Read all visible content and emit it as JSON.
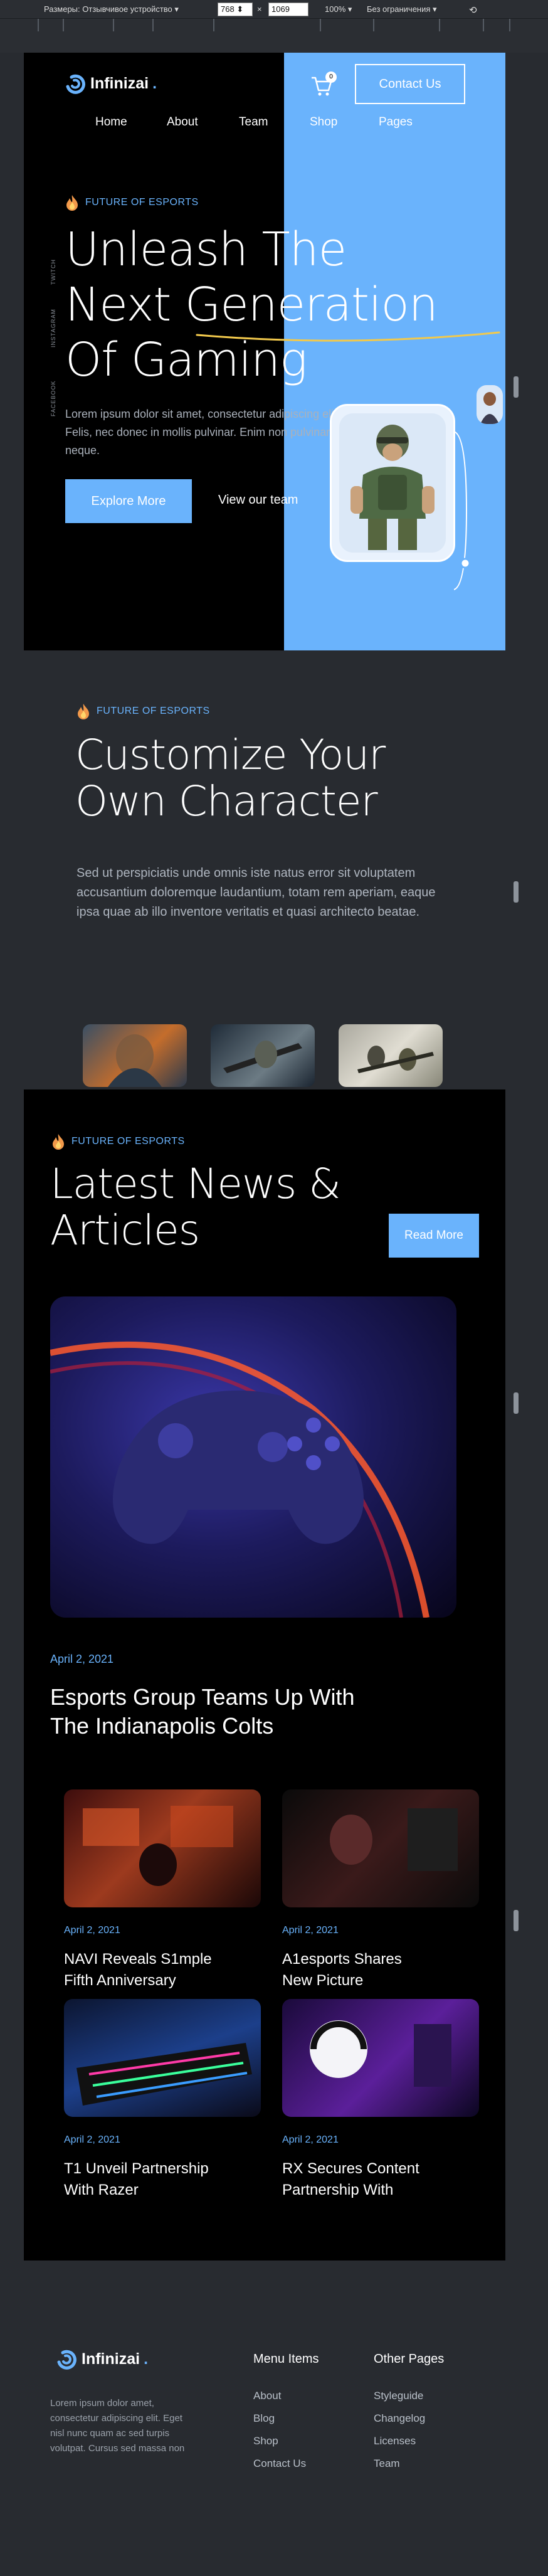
{
  "devtools": {
    "size_label": "Размеры: Отзывчивое устройство ▾",
    "width": "768",
    "times": "×",
    "height": "1069",
    "zoom": "100% ▾",
    "throttle": "Без ограничения ▾"
  },
  "header": {
    "brand": "Infinizai",
    "brand_dot": ".",
    "cart_count": "0",
    "contact_label": "Contact Us",
    "nav": [
      "Home",
      "About",
      "Team",
      "Shop",
      "Pages"
    ]
  },
  "hero": {
    "eyebrow": "FUTURE OF ESPORTS",
    "title_line1": "Unleash The",
    "title_line2": "Next Generation",
    "title_line3": "Of Gaming",
    "text": "Lorem ipsum dolor sit amet, consectetur adipiscing elit. Felis, nec donec in mollis pulvinar. Enim non pulvinar neque.",
    "primary_label": "Explore More",
    "secondary_label": "View our team",
    "socials": [
      "TWITCH",
      "INSTAGRAM",
      "FACEBOOK"
    ]
  },
  "customize": {
    "eyebrow": "FUTURE OF ESPORTS",
    "title_line1": "Customize Your",
    "title_line2": "Own Character",
    "text": "Sed ut perspiciatis unde omnis iste natus error sit voluptatem accusantium doloremque laudantium, totam rem aperiam, eaque ipsa quae ab illo inventore veritatis et quasi architecto beatae."
  },
  "news": {
    "eyebrow": "FUTURE OF ESPORTS",
    "title_line1": "Latest News &",
    "title_line2": "Articles",
    "read_more": "Read More",
    "featured": {
      "date": "April 2, 2021",
      "title_line1": "Esports Group Teams Up With",
      "title_line2": "The Indianapolis Colts"
    },
    "articles": [
      {
        "date": "April 2, 2021",
        "title_line1": "NAVI Reveals S1mple",
        "title_line2": "Fifth Anniversary"
      },
      {
        "date": "April 2, 2021",
        "title_line1": "A1esports Shares",
        "title_line2": "New Picture"
      },
      {
        "date": "April 2, 2021",
        "title_line1": "T1 Unveil Partnership",
        "title_line2": "With Razer"
      },
      {
        "date": "April 2, 2021",
        "title_line1": "RX Secures Content",
        "title_line2": "Partnership With"
      }
    ]
  },
  "footer": {
    "brand": "Infinizai",
    "brand_dot": ".",
    "about_lines": [
      "Lorem ipsum dolor amet,",
      "consectetur adipiscing elit. Eget",
      "nisl nunc quam ac sed turpis",
      "volutpat. Cursus sed massa non"
    ],
    "menu_title": "Menu Items",
    "menu": [
      "About",
      "Blog",
      "Shop",
      "Contact Us"
    ],
    "other_title": "Other Pages",
    "other": [
      "Styleguide",
      "Changelog",
      "Licenses",
      "Team"
    ]
  },
  "colors": {
    "accent": "#6ab3fc",
    "dark": "#000000",
    "panel": "#282b30",
    "underline": "#f2c94c"
  }
}
